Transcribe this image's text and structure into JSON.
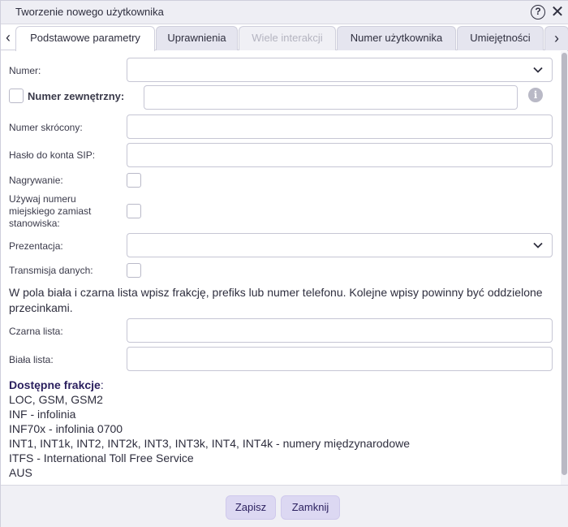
{
  "dialog": {
    "title": "Tworzenie nowego użytkownika",
    "help_icon": "?",
    "close_icon": "✕"
  },
  "tabs": [
    {
      "label": "Podstawowe parametry",
      "state": "active"
    },
    {
      "label": "Uprawnienia",
      "state": "normal"
    },
    {
      "label": "Wiele interakcji",
      "state": "disabled"
    },
    {
      "label": "Numer użytkownika",
      "state": "normal"
    },
    {
      "label": "Umiejętności",
      "state": "normal"
    }
  ],
  "tab_arrows": {
    "left": "‹",
    "right": "›"
  },
  "form": {
    "numer": {
      "label": "Numer:",
      "value": ""
    },
    "numer_zewnetrzny": {
      "label": "Numer zewnętrzny:",
      "value": "",
      "checked": false,
      "info": "i"
    },
    "numer_skrocony": {
      "label": "Numer skrócony:",
      "value": ""
    },
    "haslo_sip": {
      "label": "Hasło do konta SIP:",
      "value": ""
    },
    "nagrywanie": {
      "label": "Nagrywanie:",
      "checked": false
    },
    "numer_miejski": {
      "label_line1": "Używaj numeru",
      "label_line2": "miejskiego zamiast",
      "label_line3": "stanowiska:",
      "checked": false
    },
    "prezentacja": {
      "label": "Prezentacja:",
      "value": ""
    },
    "transmisja": {
      "label": "Transmisja danych:",
      "checked": false
    },
    "note": "W pola biała i czarna lista wpisz frakcję, prefiks lub numer telefonu. Kolejne wpisy powinny być oddzielone przecinkami.",
    "czarna_lista": {
      "label": "Czarna lista:",
      "value": ""
    },
    "biala_lista": {
      "label": "Biała lista:",
      "value": ""
    }
  },
  "fractions": {
    "title": "Dostępne frakcje",
    "title_suffix": ":",
    "lines": [
      "LOC, GSM, GSM2",
      "INF - infolinia",
      "INF70x - infolinia 0700",
      "INT1, INT1k, INT2, INT2k, INT3, INT3k, INT4, INT4k - numery międzynarodowe",
      "ITFS - International Toll Free Service",
      "AUS"
    ]
  },
  "footer": {
    "save_label": "Zapisz",
    "close_label": "Zamknij"
  },
  "colors": {
    "button_bg": "#dcd8f2",
    "button_text": "#2a1f5e",
    "tab_bg": "#e5e5ef",
    "footer_bg": "#f0f0f5"
  }
}
